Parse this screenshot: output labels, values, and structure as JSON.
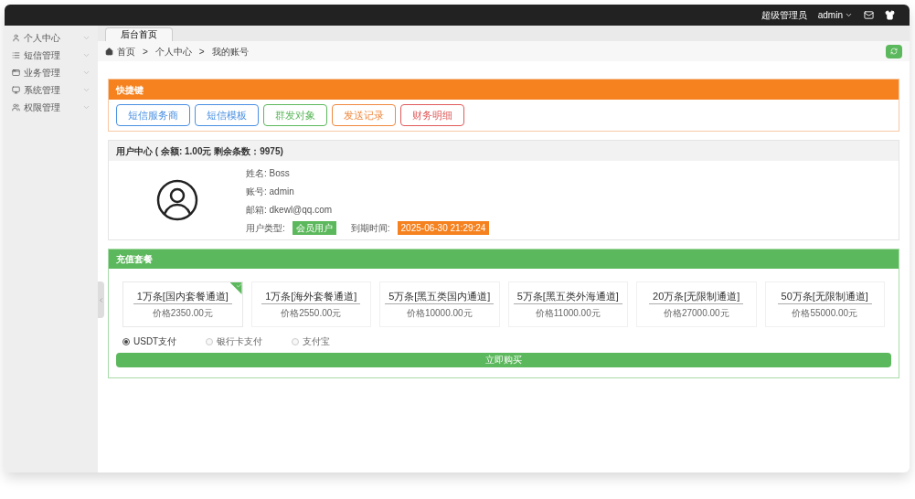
{
  "top_bar": {
    "role": "超级管理员",
    "user": "admin"
  },
  "sidebar": {
    "items": [
      {
        "label": "个人中心",
        "expanded": false
      },
      {
        "label": "短信管理",
        "expanded": false
      },
      {
        "label": "业务管理",
        "expanded": false
      },
      {
        "label": "系统管理",
        "expanded": false
      },
      {
        "label": "权限管理",
        "expanded": false
      }
    ]
  },
  "tabs": [
    {
      "label": "后台首页",
      "selected": true
    }
  ],
  "breadcrumb": {
    "separator": ">",
    "items": [
      "首页",
      "个人中心",
      "我的账号"
    ]
  },
  "shortcuts": {
    "title": "快捷键",
    "buttons": [
      {
        "label": "短信服务商",
        "color": "#4a90e2"
      },
      {
        "label": "短信模板",
        "color": "#4a90e2"
      },
      {
        "label": "群发对象",
        "color": "#5cb85c"
      },
      {
        "label": "发送记录",
        "color": "#f0883e"
      },
      {
        "label": "财务明细",
        "color": "#e05a5a"
      }
    ]
  },
  "user_center": {
    "title": "用户中心 ( 余额: 1.00元 剩余条数：9975)",
    "fields": [
      {
        "kind": "text",
        "text": "姓名: Boss"
      },
      {
        "kind": "text",
        "text": "账号: admin"
      },
      {
        "kind": "text",
        "text": "邮箱:  dkewl@qq.com"
      }
    ],
    "type_label": "用户类型:",
    "type_value": "会员用户",
    "expiry_label": "到期时间:",
    "expiry_value": "2025-06-30 21:29:24"
  },
  "recharge": {
    "title": "充值套餐",
    "packages": [
      {
        "name": "1万条[国内套餐通道]",
        "price": "价格2350.00元",
        "selected": true
      },
      {
        "name": "1万条[海外套餐通道]",
        "price": "价格2550.00元",
        "selected": false
      },
      {
        "name": "5万条[黑五类国内通道]",
        "price": "价格10000.00元",
        "selected": false
      },
      {
        "name": "5万条[黑五类外海通道]",
        "price": "价格11000.00元",
        "selected": false
      },
      {
        "name": "20万条[无限制通道]",
        "price": "价格27000.00元",
        "selected": false
      },
      {
        "name": "50万条[无限制通道]",
        "price": "价格55000.00元",
        "selected": false
      }
    ],
    "payments": [
      {
        "label": "USDT支付",
        "selected": true
      },
      {
        "label": "银行卡支付",
        "selected": false
      },
      {
        "label": "支付宝",
        "selected": false
      }
    ],
    "buy_button": "立即购买"
  }
}
